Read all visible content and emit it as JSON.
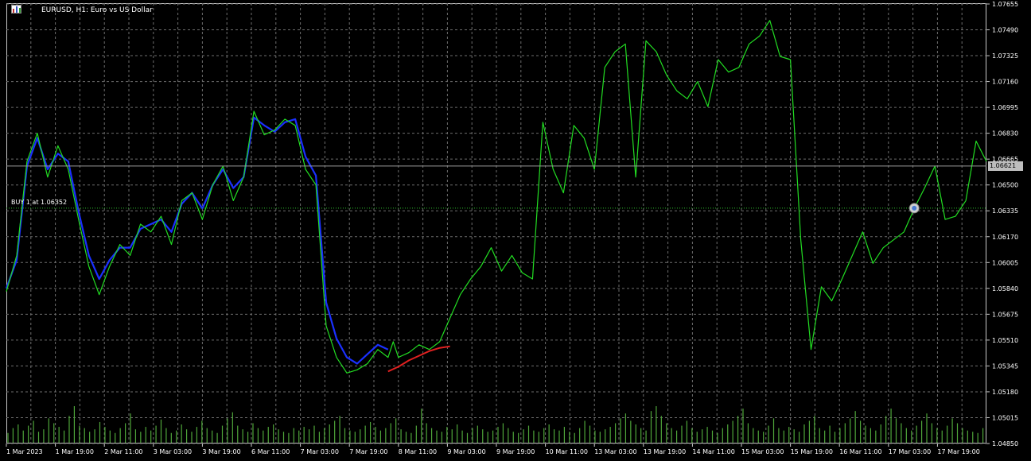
{
  "window": {
    "title": "EURUSD, H1:  Euro vs US Dollar",
    "icons": [
      "chart-window-icon",
      "bar-chart-icon"
    ]
  },
  "trade": {
    "label": "BUY",
    "qty": "1",
    "at_text": "at 1.06352",
    "price": 1.06352,
    "marker_icon": "trade-arrow-icon"
  },
  "current_price": {
    "label": "1.06621",
    "value": 1.06621
  },
  "colors": {
    "background": "#000000",
    "grid": "#6e6e6e",
    "axis_text": "#ffffff",
    "price_line": "#22dd22",
    "ma_line": "#1a30ff",
    "predict_line": "#e02020",
    "volume": "#4fa63a",
    "price_tag_bg": "#bdbdbd"
  },
  "chart_data": {
    "type": "line",
    "title": "EURUSD, H1:  Euro vs US Dollar",
    "ylim": [
      1.0485,
      1.0766
    ],
    "grid": true,
    "y_ticks": [
      "1.07655",
      "1.07490",
      "1.07325",
      "1.07160",
      "1.06995",
      "1.06830",
      "1.06665",
      "1.06500",
      "1.06335",
      "1.06170",
      "1.06005",
      "1.05840",
      "1.05675",
      "1.05510",
      "1.05345",
      "1.05180",
      "1.05015",
      "1.04850"
    ],
    "x_ticks": [
      "1 Mar 2023",
      "1 Mar 19:00",
      "2 Mar 11:00",
      "3 Mar 03:00",
      "3 Mar 19:00",
      "6 Mar 11:00",
      "7 Mar 03:00",
      "7 Mar 19:00",
      "8 Mar 11:00",
      "9 Mar 03:00",
      "9 Mar 19:00",
      "10 Mar 11:00",
      "13 Mar 03:00",
      "13 Mar 19:00",
      "14 Mar 11:00",
      "15 Mar 03:00",
      "15 Mar 19:00",
      "16 Mar 11:00",
      "17 Mar 03:00",
      "17 Mar 19:00"
    ],
    "x_range": [
      0,
      190
    ],
    "series": [
      {
        "role": "price",
        "x": [
          0,
          2,
          4,
          6,
          8,
          10,
          12,
          14,
          16,
          18,
          20,
          22,
          24,
          26,
          28,
          30,
          32,
          34,
          36,
          38,
          40,
          42,
          44,
          46,
          48,
          50,
          52,
          54,
          56,
          58,
          60,
          62,
          64,
          66,
          68,
          70,
          72,
          74,
          75,
          76,
          78,
          80,
          82,
          84,
          86,
          88,
          90,
          92,
          94,
          96,
          98,
          100,
          102,
          104,
          106,
          108,
          110,
          112,
          114,
          116,
          118,
          120,
          122,
          124,
          126,
          128,
          130,
          132,
          134,
          136,
          138,
          140,
          142,
          144,
          146,
          148,
          150,
          152,
          154,
          156,
          158,
          160,
          162,
          164,
          166,
          168,
          170,
          172,
          174,
          176,
          178,
          180,
          182,
          184,
          186,
          188,
          190
        ],
        "values": [
          1.0582,
          1.0605,
          1.0665,
          1.0683,
          1.0655,
          1.0675,
          1.066,
          1.0628,
          1.0598,
          1.058,
          1.0598,
          1.0612,
          1.0605,
          1.0625,
          1.062,
          1.063,
          1.0612,
          1.064,
          1.0645,
          1.0628,
          1.065,
          1.0662,
          1.064,
          1.0655,
          1.0697,
          1.0682,
          1.0685,
          1.0692,
          1.0688,
          1.066,
          1.065,
          1.056,
          1.054,
          1.053,
          1.0532,
          1.0536,
          1.0545,
          1.054,
          1.055,
          1.054,
          1.0543,
          1.0548,
          1.0545,
          1.055,
          1.0565,
          1.058,
          1.059,
          1.0598,
          1.061,
          1.0595,
          1.0605,
          1.0594,
          1.059,
          1.069,
          1.066,
          1.0645,
          1.0688,
          1.068,
          1.066,
          1.0725,
          1.0735,
          1.074,
          1.0655,
          1.0742,
          1.0735,
          1.072,
          1.071,
          1.0705,
          1.0716,
          1.07,
          1.073,
          1.0722,
          1.0725,
          1.074,
          1.0745,
          1.0755,
          1.0732,
          1.073,
          1.0615,
          1.0545,
          1.0585,
          1.0576,
          1.059,
          1.0605,
          1.062,
          1.06,
          1.061,
          1.0615,
          1.062,
          1.0635,
          1.0648,
          1.0662,
          1.0628,
          1.063,
          1.064,
          1.0678,
          1.0665
        ]
      },
      {
        "role": "moving_average",
        "x": [
          0,
          2,
          4,
          6,
          8,
          10,
          12,
          14,
          16,
          18,
          20,
          22,
          24,
          26,
          28,
          30,
          32,
          34,
          36,
          38,
          40,
          42,
          44,
          46,
          48,
          50,
          52,
          54,
          56,
          58,
          60,
          62,
          64,
          66,
          68,
          70,
          72,
          74
        ],
        "values": [
          1.0584,
          1.0602,
          1.0662,
          1.068,
          1.066,
          1.067,
          1.0665,
          1.0633,
          1.0605,
          1.059,
          1.0602,
          1.061,
          1.061,
          1.0622,
          1.0625,
          1.0628,
          1.062,
          1.0638,
          1.0645,
          1.0635,
          1.065,
          1.066,
          1.0648,
          1.0655,
          1.0693,
          1.0688,
          1.0684,
          1.069,
          1.0692,
          1.0668,
          1.0656,
          1.0575,
          1.0552,
          1.054,
          1.0536,
          1.0542,
          1.0548,
          1.0545
        ]
      },
      {
        "role": "prediction",
        "x": [
          74,
          76,
          78,
          80,
          82,
          84,
          86
        ],
        "values": [
          1.0531,
          1.0534,
          1.0538,
          1.0541,
          1.0544,
          1.0546,
          1.0547
        ]
      }
    ],
    "volume": {
      "x_step": 1,
      "values": [
        8,
        12,
        15,
        10,
        14,
        18,
        9,
        11,
        20,
        16,
        13,
        10,
        22,
        30,
        14,
        12,
        9,
        11,
        17,
        13,
        10,
        8,
        12,
        16,
        24,
        11,
        9,
        13,
        10,
        14,
        19,
        12,
        8,
        10,
        15,
        11,
        9,
        13,
        18,
        12,
        10,
        8,
        14,
        20,
        25,
        14,
        11,
        9,
        16,
        12,
        10,
        13,
        15,
        11,
        9,
        8,
        12,
        10,
        13,
        11,
        14,
        9,
        12,
        15,
        18,
        22,
        12,
        10,
        9,
        11,
        14,
        17,
        13,
        10,
        12,
        16,
        20,
        11,
        9,
        8,
        14,
        28,
        16,
        12,
        10,
        9,
        13,
        11,
        15,
        10,
        8,
        12,
        14,
        11,
        9,
        10,
        13,
        16,
        12,
        9,
        8,
        11,
        14,
        10,
        9,
        12,
        15,
        11,
        10,
        13,
        9,
        8,
        12,
        18,
        14,
        10,
        9,
        11,
        13,
        16,
        20,
        24,
        18,
        15,
        12,
        10,
        26,
        30,
        22,
        16,
        12,
        10,
        14,
        18,
        12,
        9,
        11,
        13,
        10,
        8,
        12,
        15,
        18,
        22,
        28,
        16,
        12,
        10,
        9,
        14,
        20,
        12,
        10,
        13,
        11,
        9,
        15,
        18,
        22,
        12,
        10,
        14,
        9,
        12,
        16,
        20,
        26,
        18,
        14,
        12,
        10,
        15,
        22,
        28,
        20,
        16,
        12,
        10,
        14,
        18,
        24,
        16,
        12,
        10,
        14,
        20,
        16,
        12,
        10,
        9,
        8,
        12
      ]
    }
  }
}
